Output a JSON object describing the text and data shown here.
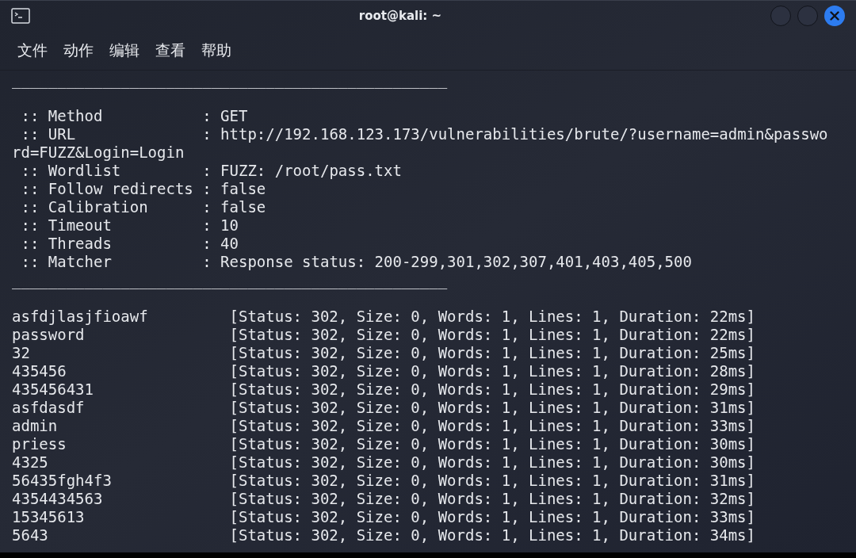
{
  "window": {
    "title": "root@kali: ~"
  },
  "menu": [
    "文件",
    "动作",
    "编辑",
    "查看",
    "帮助"
  ],
  "terminal": {
    "lines": [
      {
        "kind": "rule",
        "text": "________________________________________________"
      },
      {
        "kind": "blank"
      },
      {
        "kind": "config",
        "text": " :: Method           : GET"
      },
      {
        "kind": "config",
        "text": " :: URL              : http://192.168.123.173/vulnerabilities/brute/?username=admin&password=FUZZ&Login=Login"
      },
      {
        "kind": "config",
        "text": " :: Wordlist         : FUZZ: /root/pass.txt"
      },
      {
        "kind": "config",
        "text": " :: Follow redirects : false"
      },
      {
        "kind": "config",
        "text": " :: Calibration      : false"
      },
      {
        "kind": "config",
        "text": " :: Timeout          : 10"
      },
      {
        "kind": "config",
        "text": " :: Threads          : 40"
      },
      {
        "kind": "config",
        "text": " :: Matcher          : Response status: 200-299,301,302,307,401,403,405,500"
      },
      {
        "kind": "rule",
        "text": "________________________________________________"
      },
      {
        "kind": "blank"
      }
    ],
    "results": [
      {
        "word": "asfdjlasjfioawf",
        "info": "[Status: 302, Size: 0, Words: 1, Lines: 1, Duration: 22ms]"
      },
      {
        "word": "password",
        "info": "[Status: 302, Size: 0, Words: 1, Lines: 1, Duration: 22ms]"
      },
      {
        "word": "32",
        "info": "[Status: 302, Size: 0, Words: 1, Lines: 1, Duration: 25ms]"
      },
      {
        "word": "435456",
        "info": "[Status: 302, Size: 0, Words: 1, Lines: 1, Duration: 28ms]"
      },
      {
        "word": "435456431",
        "info": "[Status: 302, Size: 0, Words: 1, Lines: 1, Duration: 29ms]"
      },
      {
        "word": "asfdasdf",
        "info": "[Status: 302, Size: 0, Words: 1, Lines: 1, Duration: 31ms]"
      },
      {
        "word": "admin",
        "info": "[Status: 302, Size: 0, Words: 1, Lines: 1, Duration: 33ms]"
      },
      {
        "word": "priess",
        "info": "[Status: 302, Size: 0, Words: 1, Lines: 1, Duration: 30ms]"
      },
      {
        "word": "4325",
        "info": "[Status: 302, Size: 0, Words: 1, Lines: 1, Duration: 30ms]"
      },
      {
        "word": "56435fgh4f3",
        "info": "[Status: 302, Size: 0, Words: 1, Lines: 1, Duration: 31ms]"
      },
      {
        "word": "4354434563",
        "info": "[Status: 302, Size: 0, Words: 1, Lines: 1, Duration: 32ms]"
      },
      {
        "word": "15345613",
        "info": "[Status: 302, Size: 0, Words: 1, Lines: 1, Duration: 33ms]"
      },
      {
        "word": "5643",
        "info": "[Status: 302, Size: 0, Words: 1, Lines: 1, Duration: 34ms]"
      }
    ]
  }
}
